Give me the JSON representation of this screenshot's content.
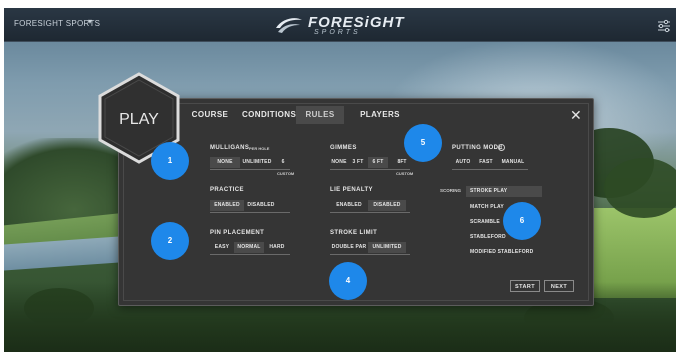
{
  "topbar": {
    "breadcrumb": "FORESIGHT SPORTS",
    "caret": "▾",
    "brand_name": "FORESiGHT",
    "brand_sub": "SPORTS"
  },
  "play": {
    "title": "PLAY"
  },
  "tabs": [
    {
      "label": "COURSE",
      "active": false
    },
    {
      "label": "CONDITIONS",
      "active": false
    },
    {
      "label": "RULES",
      "active": true
    },
    {
      "label": "PLAYERS",
      "active": false
    }
  ],
  "close_label": "✕",
  "mulligans": {
    "label": "MULLIGANS",
    "sublabel": "PER HOLE",
    "options": [
      "NONE",
      "UNLIMITED"
    ],
    "selected": "NONE",
    "value": "6",
    "value_caption": "CUSTOM"
  },
  "gimmes": {
    "label": "GIMMES",
    "options": [
      "NONE",
      "3 FT",
      "6 FT"
    ],
    "selected": "6 FT",
    "value": "8FT",
    "value_caption": "CUSTOM"
  },
  "putting_mode": {
    "label": "PUTTING MODE",
    "info": "i",
    "options": [
      "AUTO",
      "FAST",
      "MANUAL"
    ]
  },
  "practice": {
    "label": "PRACTICE",
    "options": [
      "ENABLED",
      "DISABLED"
    ],
    "selected": "ENABLED"
  },
  "lie_penalty": {
    "label": "LIE PENALTY",
    "options": [
      "ENABLED",
      "DISABLED"
    ],
    "selected": "DISABLED"
  },
  "pin_placement": {
    "label": "PIN PLACEMENT",
    "options": [
      "EASY",
      "NORMAL",
      "HARD"
    ],
    "selected": "NORMAL"
  },
  "stroke_limit": {
    "label": "STROKE LIMIT",
    "options": [
      "DOUBLE PAR",
      "UNLIMITED"
    ],
    "selected": "UNLIMITED"
  },
  "scoring": {
    "label": "SCORING",
    "options": [
      "STROKE PLAY",
      "MATCH PLAY",
      "SCRAMBLE",
      "STABLEFORD",
      "MODIFIED STABLEFORD"
    ],
    "selected": "STROKE PLAY"
  },
  "buttons": {
    "start": "START",
    "next": "NEXT"
  },
  "markers": [
    "1",
    "2",
    "4",
    "5",
    "6"
  ],
  "colors": {
    "marker": "#1e88ea",
    "dialog_bg": "#353535",
    "selected_option": "#4a4a4a"
  }
}
